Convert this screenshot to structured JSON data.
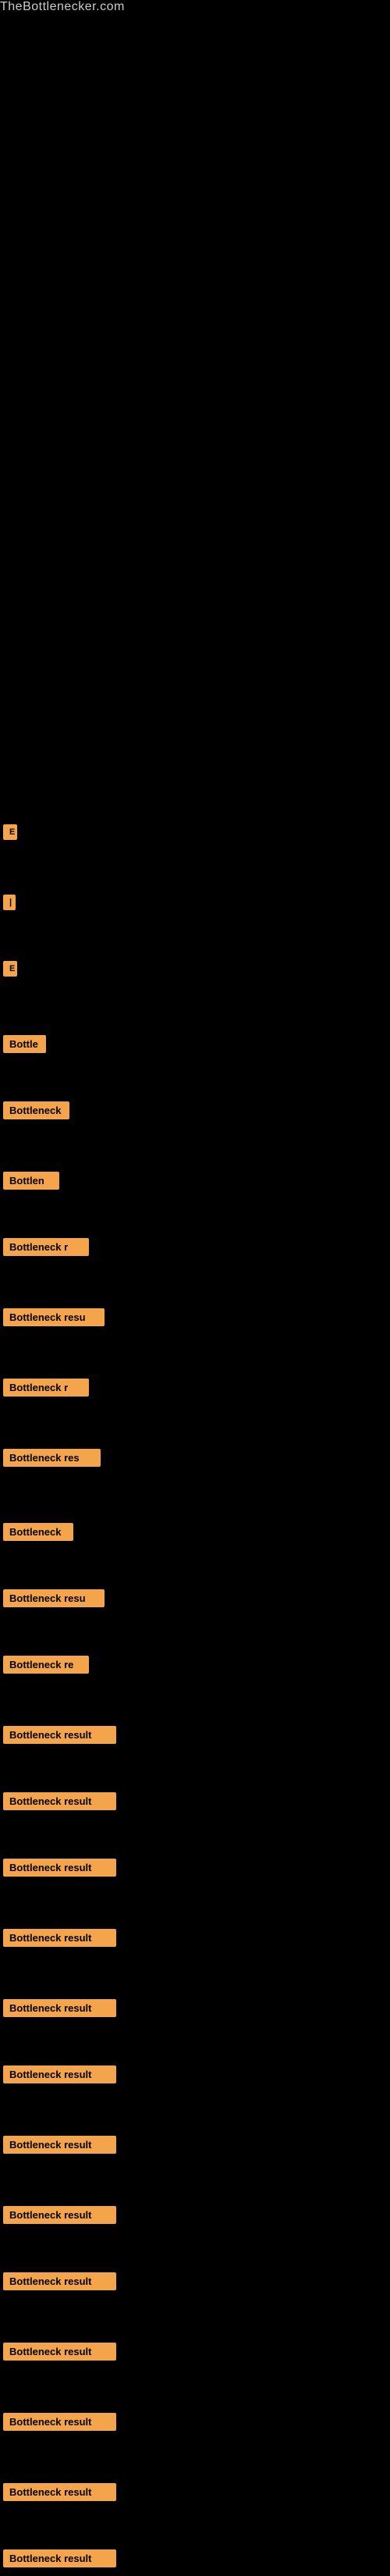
{
  "site": {
    "title": "TheBottlenecker.com"
  },
  "items": [
    {
      "id": 1,
      "label": "E",
      "class": "item-1"
    },
    {
      "id": 2,
      "label": "|",
      "class": "item-2"
    },
    {
      "id": 3,
      "label": "E",
      "class": "item-3"
    },
    {
      "id": 4,
      "label": "Bottle",
      "class": "item-4"
    },
    {
      "id": 5,
      "label": "Bottleneck",
      "class": "item-5"
    },
    {
      "id": 6,
      "label": "Bottlen",
      "class": "item-6"
    },
    {
      "id": 7,
      "label": "Bottleneck r",
      "class": "item-7"
    },
    {
      "id": 8,
      "label": "Bottleneck resu",
      "class": "item-8"
    },
    {
      "id": 9,
      "label": "Bottleneck r",
      "class": "item-9"
    },
    {
      "id": 10,
      "label": "Bottleneck res",
      "class": "item-10"
    },
    {
      "id": 11,
      "label": "Bottleneck",
      "class": "item-11"
    },
    {
      "id": 12,
      "label": "Bottleneck resu",
      "class": "item-12"
    },
    {
      "id": 13,
      "label": "Bottleneck re",
      "class": "item-13"
    },
    {
      "id": 14,
      "label": "Bottleneck result",
      "class": "item-14"
    },
    {
      "id": 15,
      "label": "Bottleneck result",
      "class": "item-15"
    },
    {
      "id": 16,
      "label": "Bottleneck result",
      "class": "item-16"
    },
    {
      "id": 17,
      "label": "Bottleneck result",
      "class": "item-17"
    },
    {
      "id": 18,
      "label": "Bottleneck result",
      "class": "item-18"
    },
    {
      "id": 19,
      "label": "Bottleneck result",
      "class": "item-19"
    },
    {
      "id": 20,
      "label": "Bottleneck result",
      "class": "item-20"
    },
    {
      "id": 21,
      "label": "Bottleneck result",
      "class": "item-21"
    },
    {
      "id": 22,
      "label": "Bottleneck result",
      "class": "item-22"
    },
    {
      "id": 23,
      "label": "Bottleneck result",
      "class": "item-23"
    },
    {
      "id": 24,
      "label": "Bottleneck result",
      "class": "item-24"
    },
    {
      "id": 25,
      "label": "Bottleneck result",
      "class": "item-25"
    },
    {
      "id": 26,
      "label": "Bottleneck result",
      "class": "item-26"
    }
  ]
}
